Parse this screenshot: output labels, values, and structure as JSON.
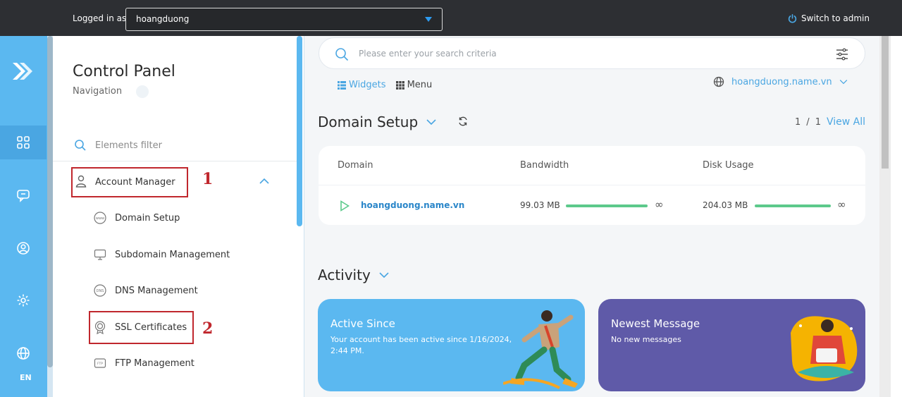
{
  "topbar": {
    "logged_in_label": "Logged in as",
    "user": "hoangduong",
    "switch_label": "Switch to admin"
  },
  "rail": {
    "items": [
      "apps-icon",
      "chat-icon",
      "user-circle-icon",
      "gear-icon",
      "globe-icon"
    ],
    "language": "EN"
  },
  "nav": {
    "title": "Control Panel",
    "subtitle": "Navigation",
    "filter_placeholder": "Elements filter",
    "account_manager": "Account Manager",
    "items": [
      "Domain Setup",
      "Subdomain Management",
      "DNS Management",
      "SSL Certificates",
      "FTP Management"
    ],
    "annotations": [
      "1",
      "2"
    ]
  },
  "main": {
    "search_placeholder": "Please enter your search criteria",
    "tabs": {
      "widgets": "Widgets",
      "menu": "Menu"
    },
    "domain_selector": "hoangduong.name.vn",
    "domain_setup": {
      "title": "Domain Setup",
      "page_current": "1",
      "page_sep": "/",
      "page_total": "1",
      "view_all": "View All",
      "columns": [
        "Domain",
        "Bandwidth",
        "Disk Usage"
      ],
      "row": {
        "domain": "hoangduong.name.vn",
        "bandwidth": "99.03 MB",
        "bandwidth_limit": "∞",
        "disk": "204.03 MB",
        "disk_limit": "∞"
      }
    },
    "activity": {
      "title": "Activity",
      "active_since_title": "Active Since",
      "active_since_text": "Your account has been active since 1/16/2024, 2:44 PM.",
      "newest_title": "Newest Message",
      "newest_text": "No new messages"
    }
  },
  "colors": {
    "accent": "#5bb8f0",
    "annotation_red": "#c0272d",
    "progress_green": "#5cc98b",
    "purple_tile": "#5f5aa8"
  }
}
